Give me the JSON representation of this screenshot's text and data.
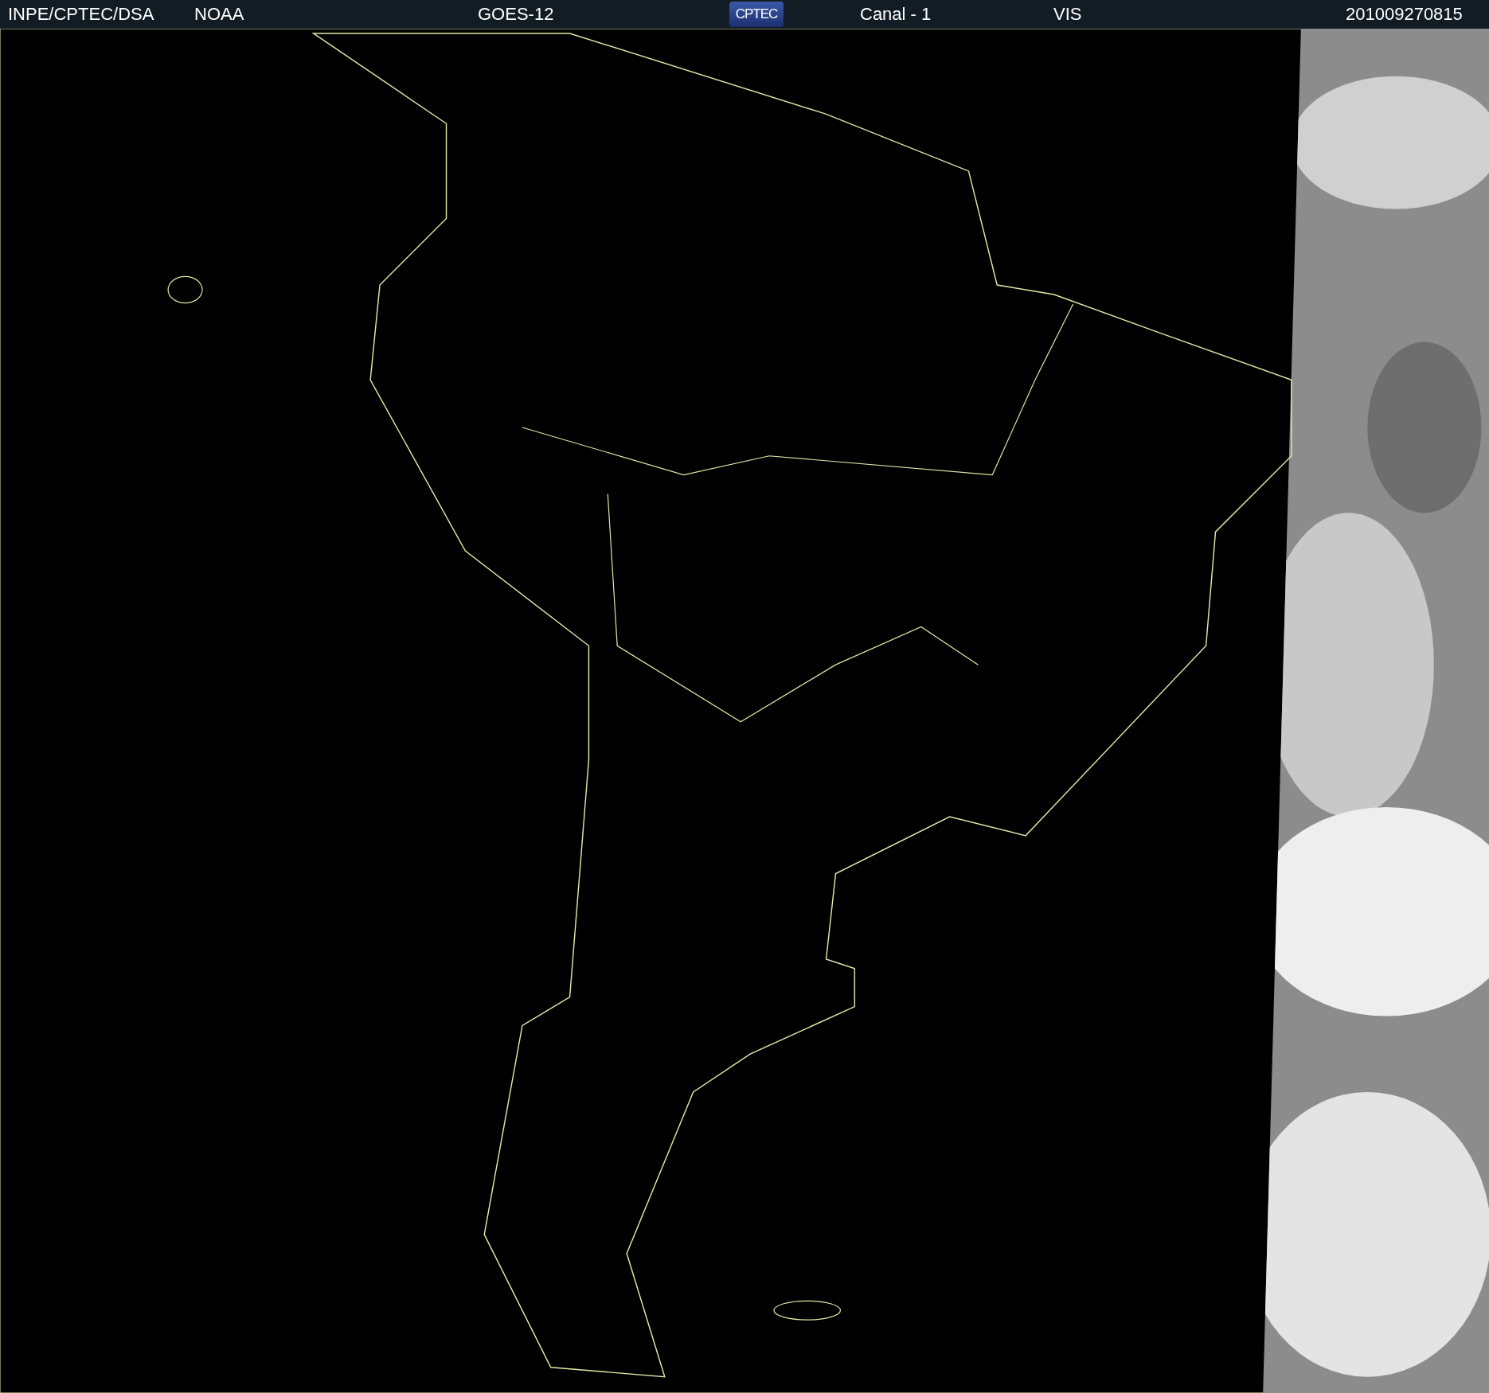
{
  "header": {
    "agency": "INPE/CPTEC/DSA",
    "source": "NOAA",
    "satellite": "GOES-12",
    "logo": "CPTEC",
    "channel": "Canal - 1",
    "band": "VIS",
    "timestamp": "201009270815"
  }
}
